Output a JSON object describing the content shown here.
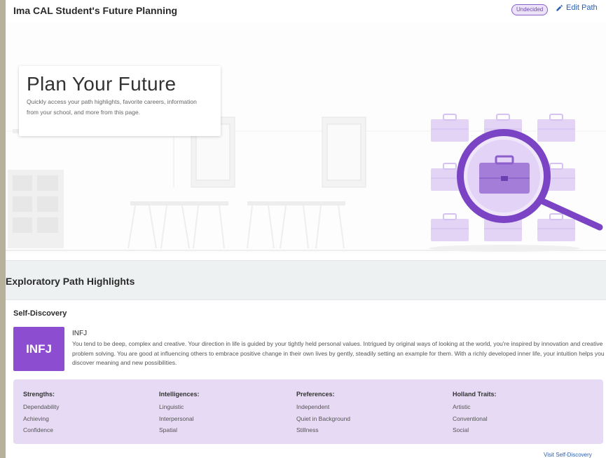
{
  "header": {
    "title": "Ima CAL Student's Future Planning",
    "status_badge": "Undecided",
    "edit_label": "Edit Path"
  },
  "hero": {
    "title": "Plan Your Future",
    "subtitle": "Quickly access your path highlights, favorite careers, information from your school, and more from this page."
  },
  "section": {
    "title": "Exploratory Path Highlights"
  },
  "self_discovery": {
    "heading": "Self-Discovery",
    "type_code": "INFJ",
    "type_name": "INFJ",
    "description": "You tend to be deep, complex and creative. Your direction in life is guided by your tightly held personal values. Intrigued by original ways of looking at the world, you're inspired by innovation and creative problem solving. You are good at influencing others to embrace positive change in their own lives by gently, steadily setting an example for them. With a richly developed inner life, your intuition helps you discover meaning and new possibilities.",
    "traits": [
      {
        "heading": "Strengths:",
        "items": [
          "Dependability",
          "Achieving",
          "Confidence"
        ]
      },
      {
        "heading": "Intelligences:",
        "items": [
          "Linguistic",
          "Interpersonal",
          "Spatial"
        ]
      },
      {
        "heading": "Preferences:",
        "items": [
          "Independent",
          "Quiet in Background",
          "Stillness"
        ]
      },
      {
        "heading": "Holland Traits:",
        "items": [
          "Artistic",
          "Conventional",
          "Social"
        ]
      }
    ],
    "visit_link": "Visit Self-Discovery"
  },
  "colors": {
    "accent_purple": "#8c4dd1",
    "light_purple": "#e6daf4",
    "link_blue": "#2a5db0"
  },
  "icons": {
    "edit": "pencil-icon",
    "hero_illustration": "magnifying-glass-briefcase-icon"
  }
}
